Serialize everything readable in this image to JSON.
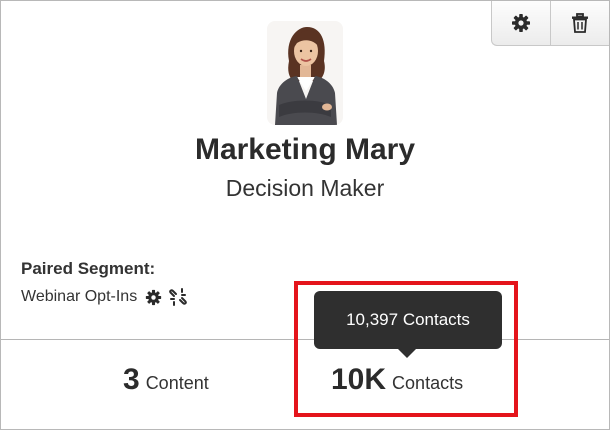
{
  "toolbar": {
    "settings_icon": "gear-icon",
    "delete_icon": "trash-icon"
  },
  "persona": {
    "avatar_icon": "businesswoman-avatar",
    "name": "Marketing Mary",
    "role": "Decision Maker"
  },
  "segment": {
    "heading": "Paired Segment:",
    "name": "Webinar Opt-Ins",
    "settings_icon": "gear-icon",
    "unlink_icon": "unlink-icon"
  },
  "stats": {
    "content": {
      "value": "3",
      "label": "Content"
    },
    "contacts": {
      "value": "10K",
      "label": "Contacts"
    }
  },
  "tooltip": {
    "text": "10,397 Contacts"
  },
  "colors": {
    "highlight": "#e4141b",
    "tooltip_bg": "#2f2f2f"
  }
}
